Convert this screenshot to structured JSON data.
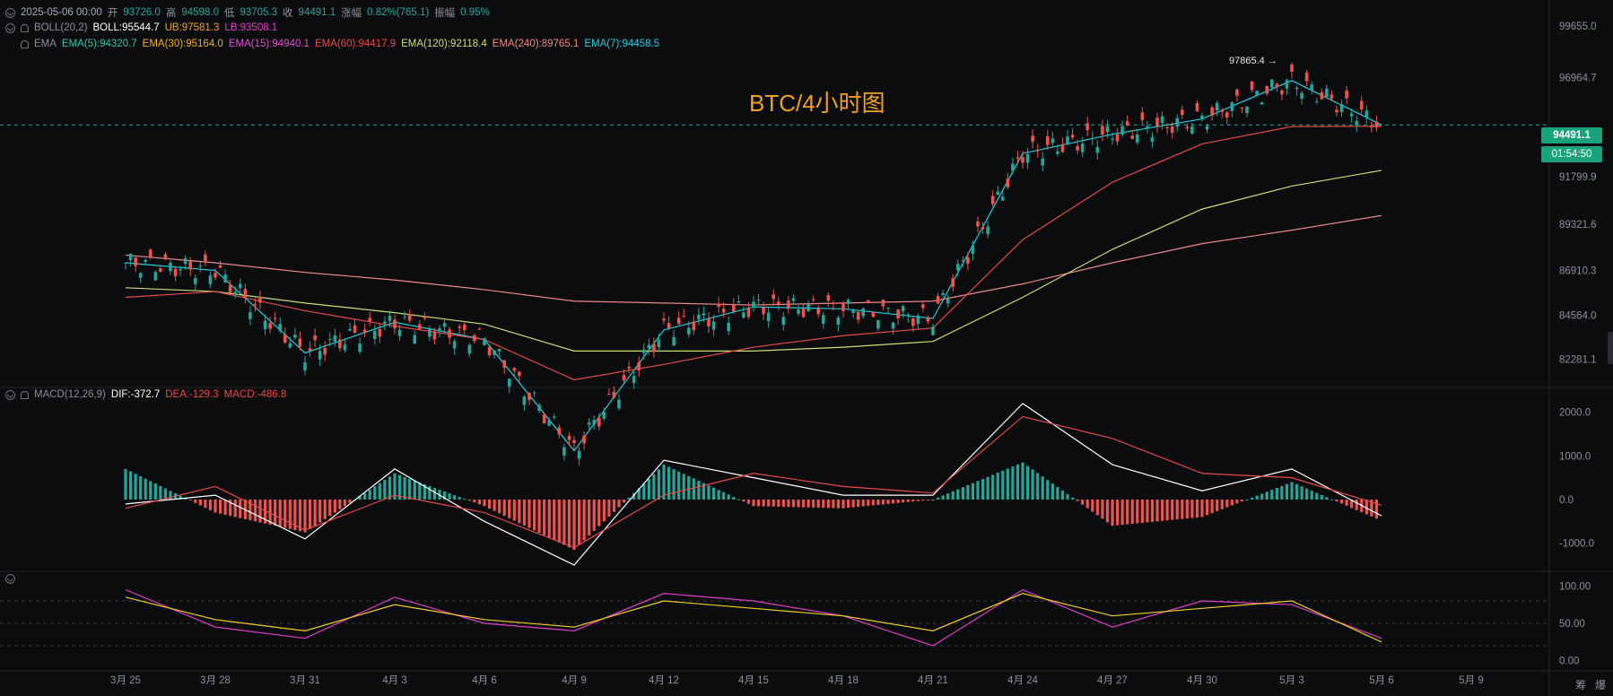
{
  "header": {
    "date": "2025-05-06 00:00",
    "open_label": "开",
    "open": "93726.0",
    "high_label": "高",
    "high": "94598.0",
    "low_label": "低",
    "low": "93705.3",
    "close_label": "收",
    "close": "94491.1",
    "change_label": "涨幅",
    "change": "0.82%(765.1)",
    "amplitude_label": "振幅",
    "amplitude": "0.95%"
  },
  "boll": {
    "name": "BOLL(20,2)",
    "mid": "BOLL:95544.7",
    "ub": "UB:97581.3",
    "lb": "LB:93508.1",
    "colors": {
      "mid": "#ffffff",
      "ub": "#f0a020",
      "lb": "#e040c8"
    }
  },
  "ema": {
    "name": "EMA",
    "items": [
      {
        "label": "EMA(5):94320.7",
        "color": "#30c8a8"
      },
      {
        "label": "EMA(30):95164.0",
        "color": "#f0b020"
      },
      {
        "label": "EMA(15):94940.1",
        "color": "#e050d0"
      },
      {
        "label": "EMA(60):94417.9",
        "color": "#e84a4a"
      },
      {
        "label": "EMA(120):92118.4",
        "color": "#c8e070"
      },
      {
        "label": "EMA(240):89765.1",
        "color": "#f08888"
      },
      {
        "label": "EMA(7):94458.5",
        "color": "#20d0e0"
      }
    ]
  },
  "macd": {
    "name": "MACD(12,26,9)",
    "dif": "DIF:-372.7",
    "dea": "DEA:-129.3",
    "macd": "MACD:-486.8",
    "colors": {
      "dif": "#ffffff",
      "dea": "#e84a4a",
      "macd": "#e84a4a"
    }
  },
  "watermark": "BTC/4小时图",
  "last_price": "94491.1",
  "countdown": "01:54:50",
  "high_marker": "97865.4",
  "price_axis": [
    "99655.0",
    "96964.7",
    "94491.1",
    "91799.9",
    "89321.6",
    "86910.3",
    "84564.0",
    "82281.1"
  ],
  "macd_axis": [
    "2000.0",
    "1000.0",
    "0.0",
    "-1000.0"
  ],
  "osc_axis": [
    "100.00",
    "50.00",
    "0.00"
  ],
  "date_axis": [
    "3月 25",
    "3月 28",
    "3月 31",
    "4月 3",
    "4月 6",
    "4月 9",
    "4月 12",
    "4月 15",
    "4月 18",
    "4月 21",
    "4月 24",
    "4月 27",
    "4月 30",
    "5月 3",
    "5月 6",
    "5月 9"
  ],
  "bottom_icons": [
    "筹",
    "爆"
  ],
  "colors": {
    "up": "#26a69a",
    "down": "#ef5350",
    "background": "#0b0c0e",
    "grid": "#1b1d21",
    "text": "#a8adb5"
  },
  "chart_data": [
    {
      "type": "candlestick",
      "title": "BTC/4小时图",
      "ylim": [
        80800,
        101000
      ],
      "x": [
        "3月 25",
        "3月 28",
        "3月 31",
        "4月 3",
        "4月 6",
        "4月 9",
        "4月 12",
        "4月 15",
        "4月 18",
        "4月 21",
        "4月 24",
        "4月 27",
        "4月 30",
        "5月 3",
        "5月 6"
      ],
      "series": [
        {
          "name": "close",
          "values": [
            87300,
            86900,
            82600,
            84200,
            83300,
            77500,
            83800,
            85000,
            84900,
            84400,
            93000,
            94000,
            94800,
            96800,
            94491
          ]
        },
        {
          "name": "EMA(240)",
          "values": [
            87700,
            87300,
            86800,
            86400,
            85900,
            85300,
            85200,
            85100,
            85200,
            85300,
            86200,
            87300,
            88300,
            89000,
            89765
          ]
        },
        {
          "name": "EMA(120)",
          "values": [
            86000,
            85800,
            85200,
            84700,
            84100,
            82700,
            82700,
            82700,
            82900,
            83200,
            85500,
            88000,
            90100,
            91300,
            92118
          ]
        },
        {
          "name": "EMA(60)",
          "values": [
            85500,
            85800,
            84800,
            84000,
            83300,
            81200,
            82000,
            82900,
            83500,
            83900,
            88500,
            91500,
            93500,
            94400,
            94418
          ]
        }
      ],
      "high_marker": 97865.4,
      "last_price": 94491.1
    },
    {
      "type": "bar",
      "title": "MACD(12,26,9)",
      "ylim": [
        -1500,
        2300
      ],
      "categories": [
        "3月 25",
        "3月 28",
        "3月 31",
        "4月 3",
        "4月 6",
        "4月 9",
        "4月 12",
        "4月 15",
        "4月 18",
        "4月 21",
        "4月 24",
        "4月 27",
        "4月 30",
        "5月 3",
        "5月 6"
      ],
      "series": [
        {
          "name": "MACD",
          "values": [
            700,
            -300,
            -750,
            600,
            -150,
            -1150,
            800,
            -150,
            -200,
            0,
            850,
            -600,
            -400,
            400,
            -486.8
          ]
        },
        {
          "name": "DIF",
          "values": [
            -100,
            100,
            -900,
            700,
            -500,
            -1500,
            900,
            500,
            100,
            100,
            2200,
            800,
            200,
            700,
            -372.7
          ]
        },
        {
          "name": "DEA",
          "values": [
            -200,
            300,
            -700,
            100,
            -300,
            -1100,
            100,
            600,
            300,
            150,
            1900,
            1400,
            600,
            500,
            -129.3
          ]
        }
      ]
    },
    {
      "type": "line",
      "ylim": [
        -10,
        110
      ],
      "categories": [
        "3月 25",
        "3月 28",
        "3月 31",
        "4月 3",
        "4月 6",
        "4月 9",
        "4月 12",
        "4月 15",
        "4月 18",
        "4月 21",
        "4月 24",
        "4月 27",
        "4月 30",
        "5月 3",
        "5月 6"
      ],
      "series": [
        {
          "values": [
            95,
            45,
            30,
            85,
            50,
            40,
            90,
            80,
            60,
            20,
            95,
            45,
            80,
            75,
            30
          ]
        },
        {
          "values": [
            85,
            55,
            40,
            75,
            55,
            45,
            80,
            70,
            60,
            40,
            90,
            60,
            70,
            80,
            25
          ]
        }
      ]
    }
  ]
}
